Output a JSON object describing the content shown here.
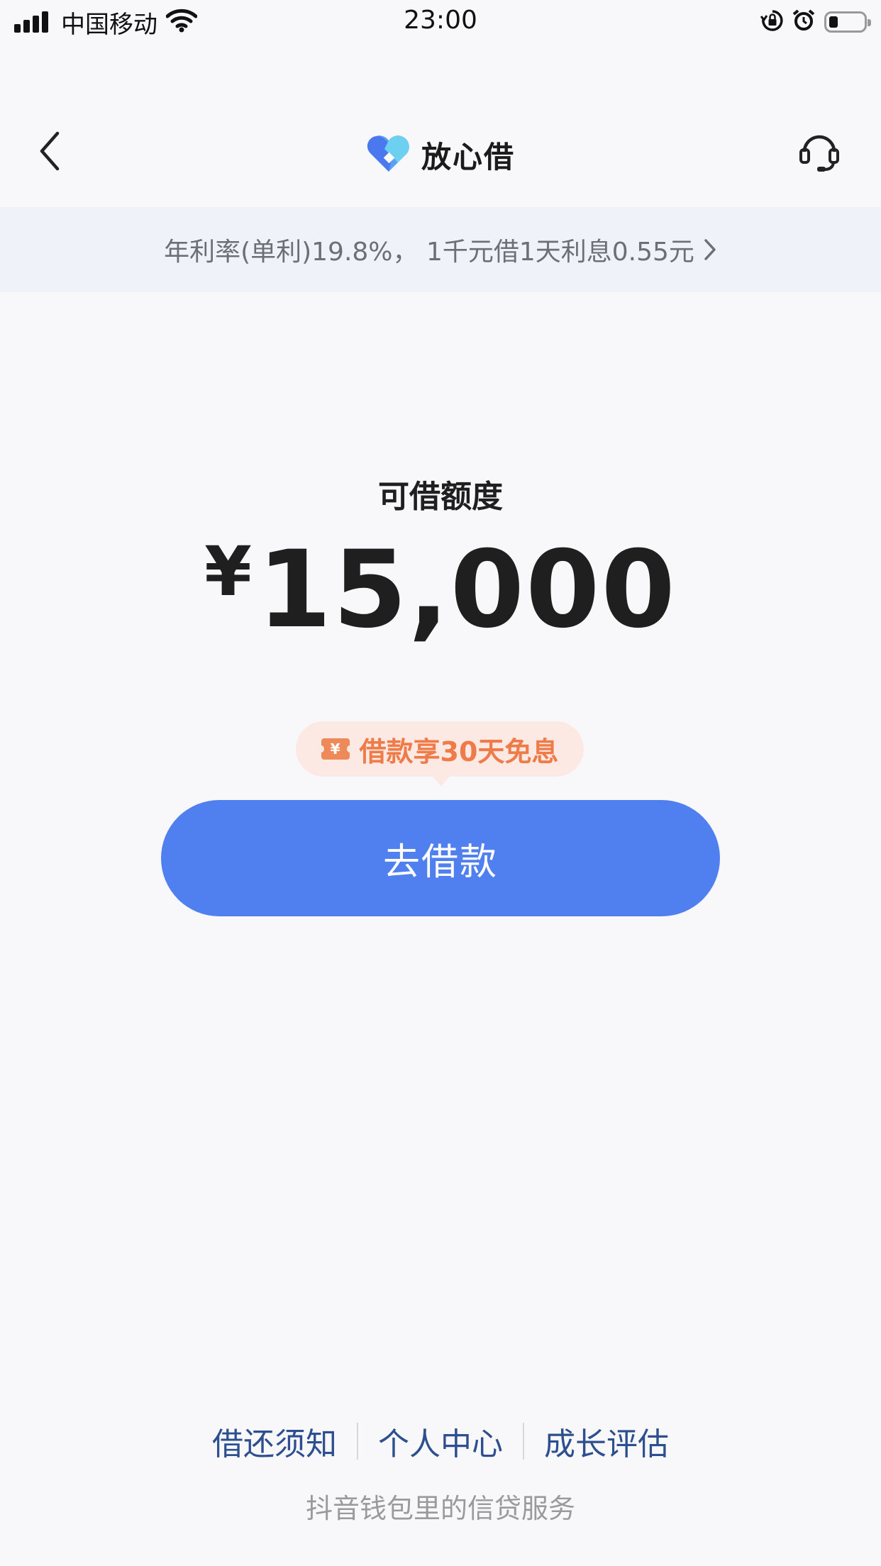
{
  "status_bar": {
    "carrier": "中国移动",
    "time": "23:00"
  },
  "header": {
    "title": "放心借"
  },
  "rate_banner": {
    "text": "年利率(单利)19.8%， 1千元借1天利息0.55元"
  },
  "credit": {
    "label": "可借额度",
    "currency": "¥",
    "amount": "15,000"
  },
  "promo": {
    "coupon_symbol": "¥",
    "text": "借款享30天免息"
  },
  "borrow_button": {
    "label": "去借款"
  },
  "footer": {
    "links": [
      "借还须知",
      "个人中心",
      "成长评估"
    ],
    "note": "抖音钱包里的信贷服务"
  },
  "colors": {
    "primary_button": "#5080f0",
    "promo_text": "#ee7b48",
    "footer_link": "#2d4f8f"
  }
}
